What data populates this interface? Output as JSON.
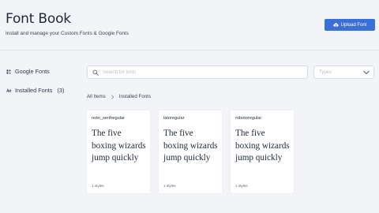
{
  "header": {
    "title": "Font Book",
    "subtitle": "Install and manage your Custom Fonts & Google Fonts",
    "upload_label": "Upload Font",
    "upload_icon": "cloud-upload-icon"
  },
  "sidebar": {
    "items": [
      {
        "label": "Google Fonts",
        "icon": "google-fonts-icon"
      },
      {
        "label": "Installed Fonts",
        "count": "(3)",
        "icon": "installed-fonts-icon"
      }
    ]
  },
  "search": {
    "placeholder": "Search for fonts",
    "value": ""
  },
  "types_select": {
    "placeholder": "Types"
  },
  "breadcrumb": {
    "items": [
      "All Items",
      "Installed Fonts"
    ]
  },
  "fonts": [
    {
      "name": "noto_serifregular",
      "sample": "The five boxing wizards jump quickly",
      "styles": "1 styles"
    },
    {
      "name": "latoregular",
      "sample": "The five boxing wizards jump quickly",
      "styles": "1 styles"
    },
    {
      "name": "robotoregular",
      "sample": "The five boxing wizards jump quickly",
      "styles": "1 styles"
    }
  ],
  "colors": {
    "background": "#f2f4f7",
    "accent": "#3b6fd8",
    "card": "#ffffff"
  }
}
